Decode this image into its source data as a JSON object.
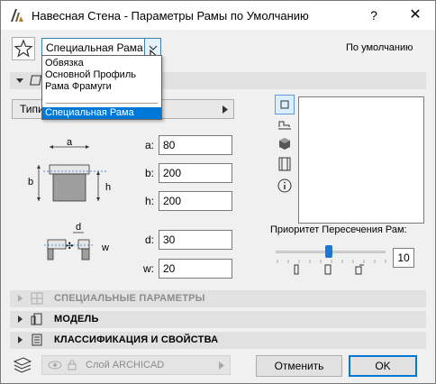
{
  "window": {
    "title": "Навесная Стена - Параметры Рамы по Умолчанию",
    "help_glyph": "?",
    "close_glyph": "✕"
  },
  "header": {
    "favorites_icon": "star-icon",
    "combo_value": "Специальная Рама",
    "default_label": "По умолчанию"
  },
  "dropdown": {
    "items": [
      "Обвязка",
      "Основной Профиль",
      "Рама Фрамуги"
    ],
    "selected": "Специальная Рама"
  },
  "geometry_panel": {
    "tab_label": "Типи",
    "fields": [
      {
        "label": "a:",
        "value": "80"
      },
      {
        "label": "b:",
        "value": "200"
      },
      {
        "label": "h:",
        "value": "200"
      },
      {
        "label": "d:",
        "value": "30"
      },
      {
        "label": "w:",
        "value": "20"
      }
    ],
    "diagram_labels": {
      "a": "a",
      "b": "b",
      "h": "h",
      "d": "d",
      "w": "w"
    }
  },
  "side_tools": [
    "plan-view-icon",
    "profile-icon",
    "3d-cube-icon",
    "filmstrip-icon",
    "info-icon"
  ],
  "priority": {
    "label": "Приоритет Пересечения Рам:",
    "value": "10",
    "slider_fraction": 0.45
  },
  "sections": [
    {
      "label": "СПЕЦИАЛЬНЫЕ ПАРАМЕТРЫ",
      "disabled": true
    },
    {
      "label": "МОДЕЛЬ",
      "disabled": false
    },
    {
      "label": "КЛАССИФИКАЦИЯ И СВОЙСТВА",
      "disabled": false
    }
  ],
  "footer": {
    "layer_label": "Слой ARCHICAD",
    "cancel_label": "Отменить",
    "ok_label": "OK"
  },
  "colors": {
    "accent": "#0078d7",
    "selection": "#0078d7"
  }
}
